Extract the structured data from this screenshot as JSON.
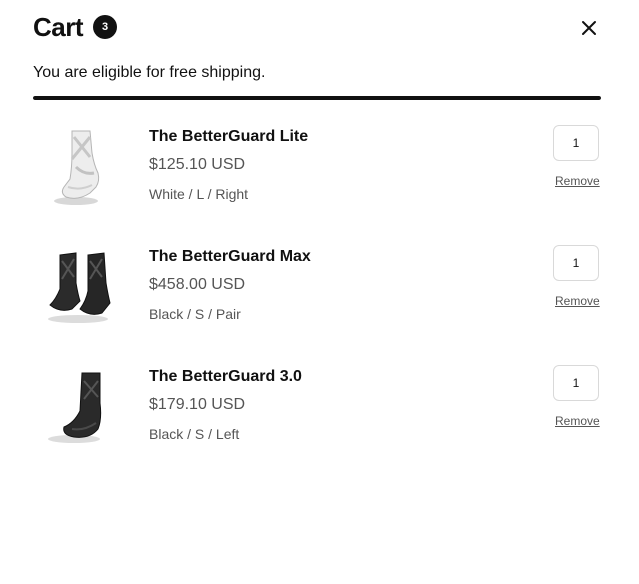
{
  "cart": {
    "title": "Cart",
    "count": "3",
    "close_icon": "close-icon",
    "shipping_message": "You are eligible for free shipping.",
    "shipping_progress": 1.0,
    "progress_color": "#111111"
  },
  "items": [
    {
      "name": "The BetterGuard Lite",
      "price": "$125.10 USD",
      "variant": "White / L / Right",
      "quantity": "1",
      "remove_label": "Remove",
      "image": "white-ankle-brace-image"
    },
    {
      "name": "The BetterGuard Max",
      "price": "$458.00 USD",
      "variant": "Black / S / Pair",
      "quantity": "1",
      "remove_label": "Remove",
      "image": "black-ankle-brace-pair-image"
    },
    {
      "name": "The BetterGuard 3.0",
      "price": "$179.10 USD",
      "variant": "Black / S / Left",
      "quantity": "1",
      "remove_label": "Remove",
      "image": "black-ankle-brace-image"
    }
  ]
}
